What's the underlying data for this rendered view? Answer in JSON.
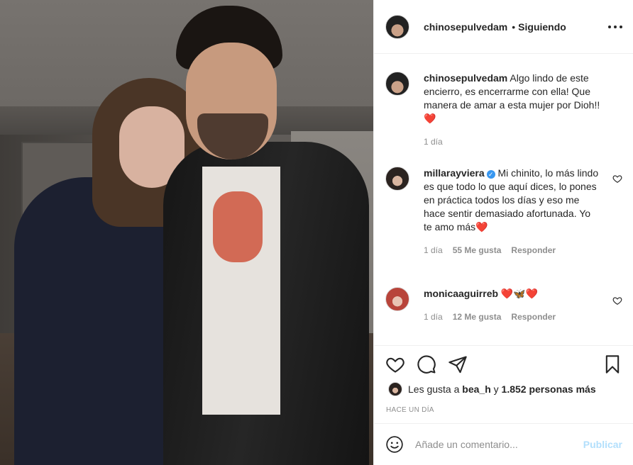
{
  "post": {
    "photo_alt": "Foto de pareja"
  },
  "header": {
    "username": "chinosepulvedam",
    "separator": "•",
    "follow_status": "Siguiendo"
  },
  "caption": {
    "username": "chinosepulvedam",
    "text": "Algo lindo de este encierro, es encerrarme con ella! Que manera de amar a esta mujer por Dioh!!",
    "emoji": "❤️",
    "time": "1 día"
  },
  "comments": [
    {
      "username": "millarayviera",
      "verified": true,
      "text": "Mi chinito, lo más lindo es que todo lo que aquí dices, lo pones en práctica todos los días y eso me hace sentir demasiado afortunada. Yo te amo más",
      "emoji": "❤️",
      "time": "1 día",
      "likes": "55 Me gusta",
      "reply": "Responder"
    },
    {
      "username": "monicaaguirreb",
      "verified": false,
      "text": "",
      "emoji": "❤️🦋❤️",
      "time": "1 día",
      "likes": "12 Me gusta",
      "reply": "Responder"
    }
  ],
  "likes": {
    "prefix": "Les gusta a",
    "user": "bea_h",
    "connector": "y",
    "others": "1.852 personas más"
  },
  "timestamp": "HACE UN DÍA",
  "add_comment": {
    "placeholder": "Añade un comentario...",
    "publish": "Publicar"
  },
  "colors": {
    "heart": "#e0245e",
    "verified": "#3897f0",
    "publish_disabled": "#b2dffc",
    "muted": "#8e8e8e"
  }
}
